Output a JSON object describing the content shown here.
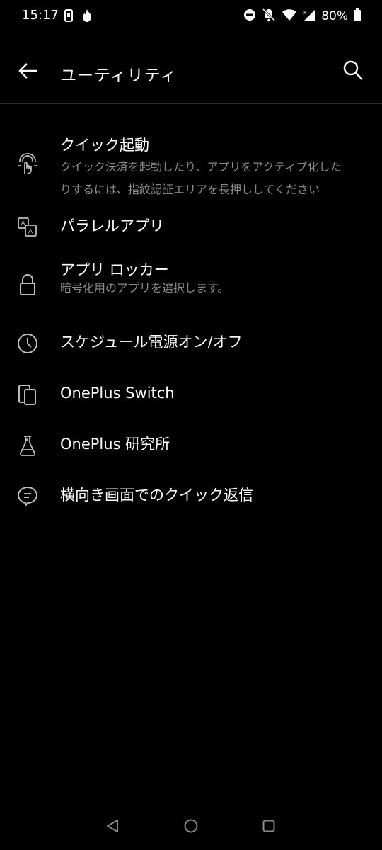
{
  "status_bar": {
    "time": "15:17",
    "battery": "80%",
    "icons": [
      "sim-card-icon",
      "flame-icon",
      "do-not-disturb-icon",
      "bell-off-icon",
      "wifi-icon",
      "signal-icon",
      "battery-icon"
    ]
  },
  "toolbar": {
    "title": "ユーティリティ",
    "back_icon": "arrow-left-icon",
    "search_icon": "search-icon"
  },
  "items": [
    {
      "title": "クイック起動",
      "summary_line1": "クイック決済を起動したり、アプリをアクティブ化した",
      "summary_line2": "りするには、指紋認証エリアを長押ししてください",
      "icon": "fingerprint-touch-icon"
    },
    {
      "title": "パラレルアプリ",
      "icon": "parallel-apps-icon"
    },
    {
      "title": "アプリ ロッカー",
      "summary": "暗号化用のアプリを選択します。",
      "icon": "lock-icon"
    },
    {
      "title": "スケジュール電源オン/オフ",
      "icon": "clock-icon"
    },
    {
      "title": "OnePlus Switch",
      "icon": "phone-switch-icon"
    },
    {
      "title": "OnePlus 研究所",
      "icon": "flask-icon"
    },
    {
      "title": "横向き画面でのクイック返信",
      "icon": "chat-bubble-icon"
    }
  ],
  "nav_bar": {
    "icons": [
      "nav-back-icon",
      "nav-home-icon",
      "nav-recent-icon"
    ]
  }
}
